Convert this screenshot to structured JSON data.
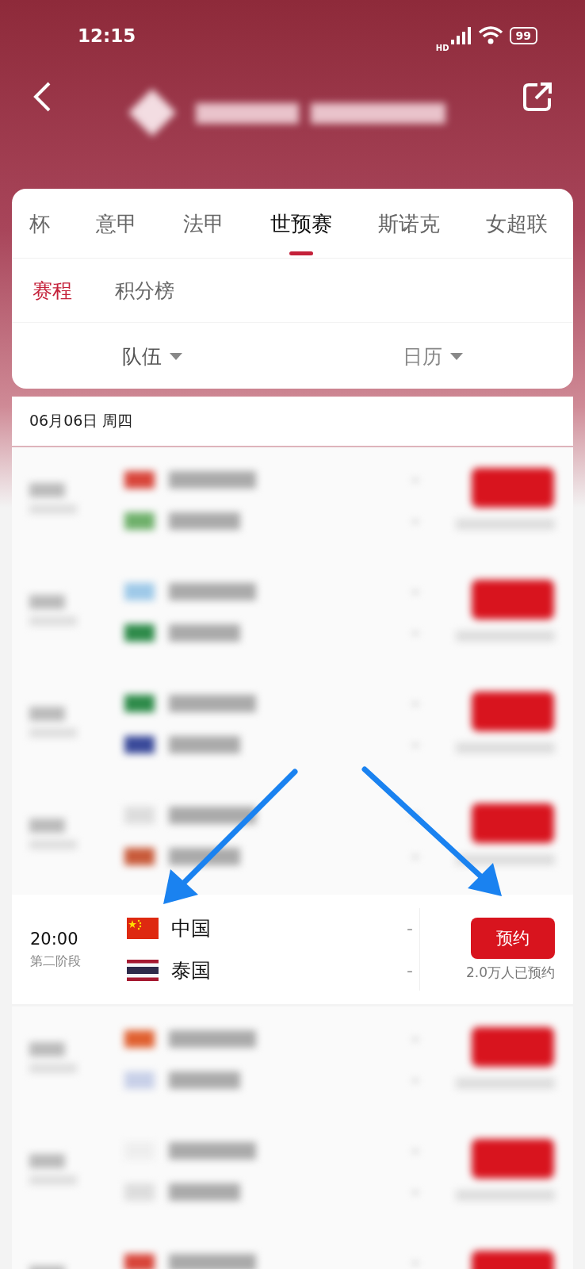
{
  "status_bar": {
    "time": "12:15",
    "network_label": "HD",
    "battery": "99"
  },
  "header": {
    "kind": "blurred"
  },
  "tabs": [
    {
      "label": "杯",
      "selected": false
    },
    {
      "label": "意甲",
      "selected": false
    },
    {
      "label": "法甲",
      "selected": false
    },
    {
      "label": "世预赛",
      "selected": true
    },
    {
      "label": "斯诺克",
      "selected": false
    },
    {
      "label": "女超联",
      "selected": false
    }
  ],
  "sub_tabs": [
    {
      "label": "赛程",
      "selected": true
    },
    {
      "label": "积分榜",
      "selected": false
    }
  ],
  "filters": [
    {
      "label": "队伍"
    },
    {
      "label": "日历"
    }
  ],
  "date": "06月06日 周四",
  "matches": [
    {
      "kind": "blurred"
    },
    {
      "kind": "blurred"
    },
    {
      "kind": "blurred"
    },
    {
      "kind": "blurred"
    },
    {
      "kind": "match",
      "time": "20:00",
      "stage": "第二阶段",
      "teams": [
        {
          "kind": "china",
          "name": "中国",
          "score": "-"
        },
        {
          "kind": "thailand",
          "name": "泰国",
          "score": "-"
        }
      ],
      "button": "预约",
      "count": "2.0万人已预约"
    },
    {
      "kind": "blurred"
    },
    {
      "kind": "blurred"
    },
    {
      "kind": "blurred"
    }
  ]
}
